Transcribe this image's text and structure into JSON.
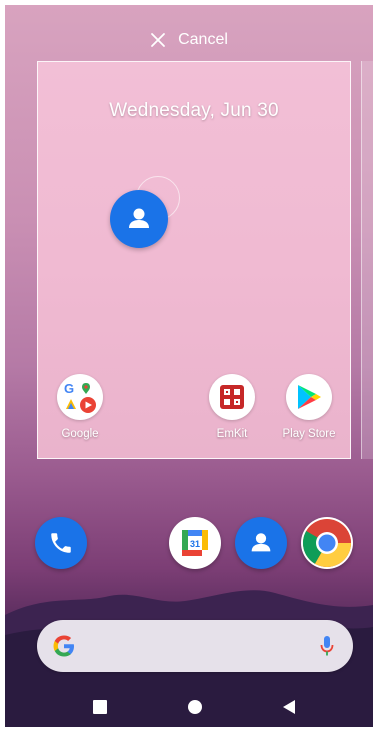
{
  "top_bar": {
    "cancel_label": "Cancel",
    "close_icon": "close-icon"
  },
  "preview": {
    "date": "Wednesday, Jun 30",
    "dragged_app": "contacts-icon",
    "apps": [
      {
        "label": "Google",
        "icon": "google-folder-icon"
      },
      {
        "label": "EmKit",
        "icon": "emkit-icon"
      },
      {
        "label": "Play Store",
        "icon": "play-store-icon"
      }
    ]
  },
  "dock": {
    "apps": [
      "phone-icon",
      "calendar-icon",
      "contacts-icon",
      "chrome-icon"
    ],
    "calendar_day": "31"
  },
  "search": {
    "logo": "google-g-icon",
    "mic": "mic-icon"
  },
  "nav": [
    "recents-icon",
    "home-icon",
    "back-icon"
  ],
  "colors": {
    "accent_blue": "#1a73e8",
    "preview_bg": "#f0bad2",
    "search_bg": "#e6e1ea"
  }
}
